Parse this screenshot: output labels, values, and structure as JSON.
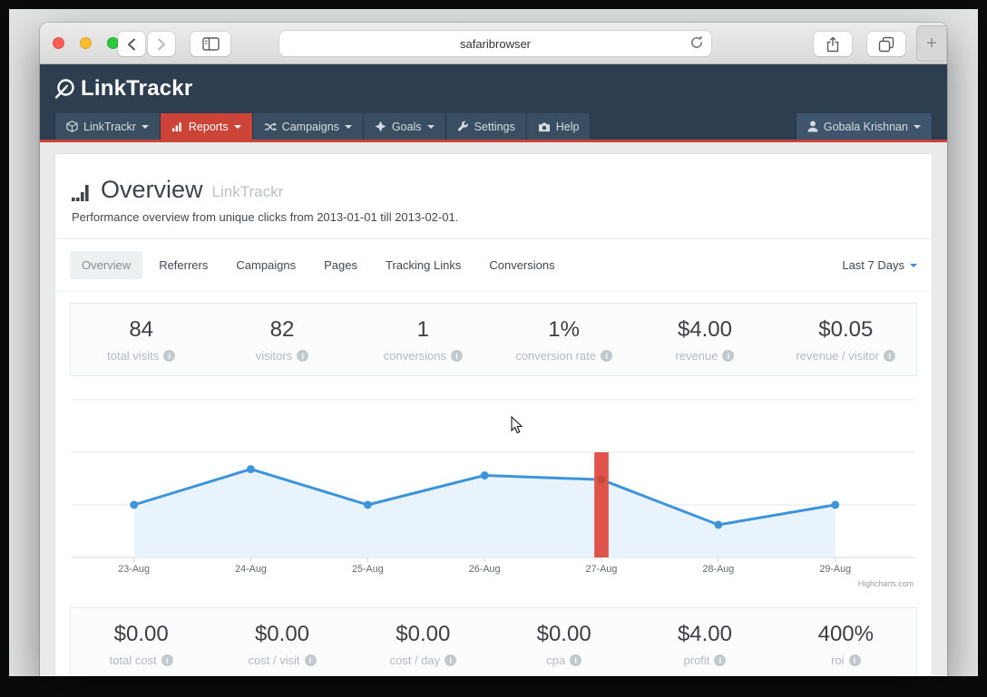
{
  "browser": {
    "url": "safaribrowser",
    "newtab_label": "+"
  },
  "app": {
    "brand": "LinkTrackr",
    "nav": {
      "items": [
        {
          "label": "LinkTrackr",
          "caret": true
        },
        {
          "label": "Reports",
          "caret": true,
          "active": true
        },
        {
          "label": "Campaigns",
          "caret": true
        },
        {
          "label": "Goals",
          "caret": true
        },
        {
          "label": "Settings",
          "caret": false
        },
        {
          "label": "Help",
          "caret": false
        }
      ],
      "user": "Gobala Krishnan"
    },
    "page": {
      "title": "Overview",
      "title_suffix": "LinkTrackr",
      "subtitle": "Performance overview from unique clicks from 2013-01-01 till 2013-02-01."
    },
    "tabs": {
      "items": [
        "Overview",
        "Referrers",
        "Campaigns",
        "Pages",
        "Tracking Links",
        "Conversions"
      ],
      "active": "Overview",
      "range_selector": "Last 7 Days"
    },
    "stats_top": [
      {
        "value": "84",
        "label": "total visits"
      },
      {
        "value": "82",
        "label": "visitors"
      },
      {
        "value": "1",
        "label": "conversions"
      },
      {
        "value": "1%",
        "label": "conversion rate"
      },
      {
        "value": "$4.00",
        "label": "revenue"
      },
      {
        "value": "$0.05",
        "label": "revenue / visitor"
      }
    ],
    "stats_bottom": [
      {
        "value": "$0.00",
        "label": "total cost"
      },
      {
        "value": "$0.00",
        "label": "cost / visit"
      },
      {
        "value": "$0.00",
        "label": "cost / day"
      },
      {
        "value": "$0.00",
        "label": "cpa"
      },
      {
        "value": "$4.00",
        "label": "profit"
      },
      {
        "value": "400%",
        "label": "roi"
      }
    ]
  },
  "chart_data": {
    "type": "line",
    "title": "",
    "xlabel": "",
    "ylabel": "",
    "categories": [
      "23-Aug",
      "24-Aug",
      "25-Aug",
      "26-Aug",
      "27-Aug",
      "28-Aug",
      "29-Aug"
    ],
    "series": [
      {
        "name": "unique clicks",
        "type": "area-line",
        "color": "#3d94da",
        "fill": "#e9f3fb",
        "values": [
          5,
          8.4,
          5,
          7.8,
          7.4,
          3.1,
          5
        ]
      },
      {
        "name": "highlight-column",
        "type": "column",
        "color": "#e0534a",
        "category": "27-Aug",
        "value": 10
      }
    ],
    "ylim": [
      0,
      15
    ],
    "yticks": [
      0,
      5,
      10,
      15
    ],
    "grid": "horizontal-only",
    "legend": "none",
    "credit": "Highcharts.com"
  }
}
